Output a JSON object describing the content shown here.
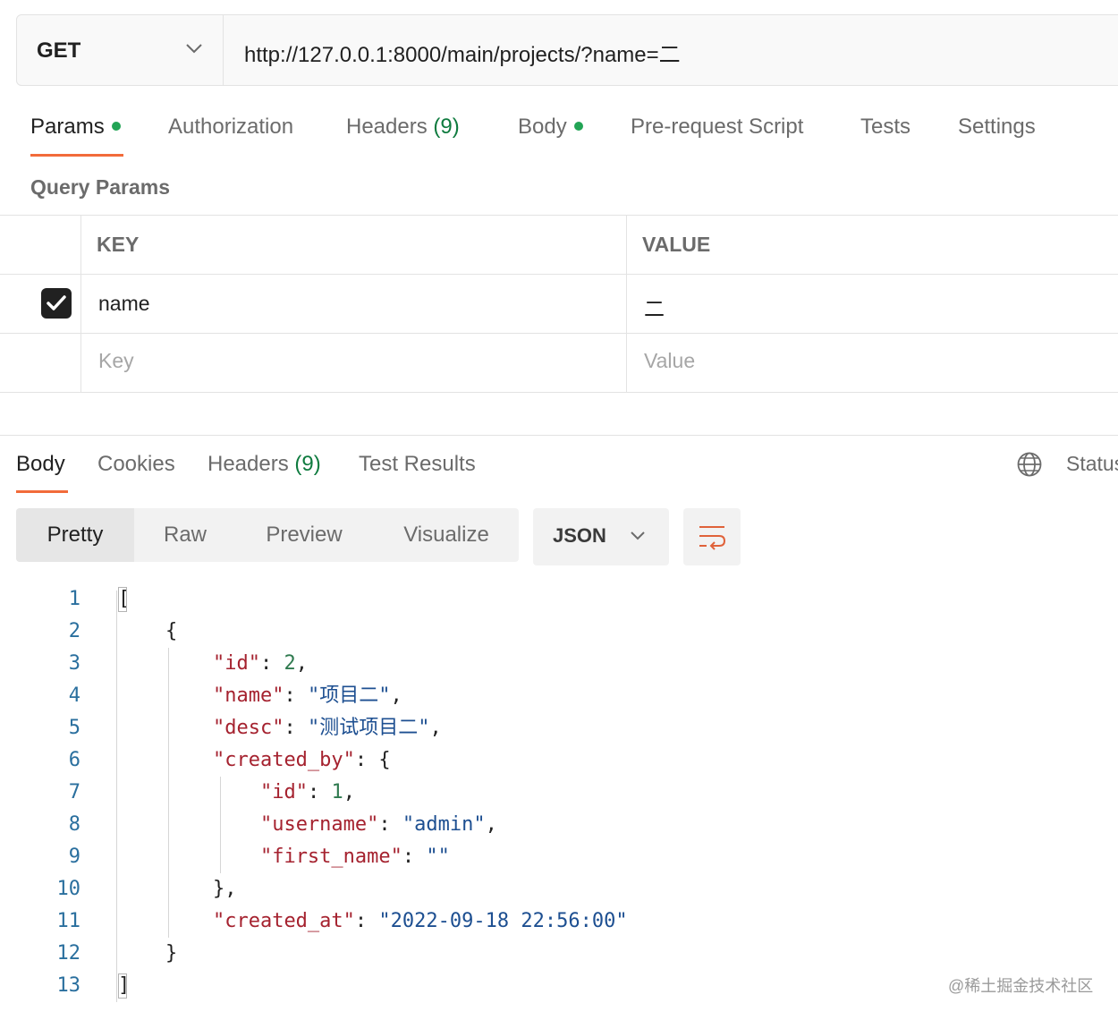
{
  "request": {
    "method": "GET",
    "url": "http://127.0.0.1:8000/main/projects/?name=二"
  },
  "request_tabs": [
    {
      "label": "Params",
      "count": "",
      "dot": true,
      "active": true
    },
    {
      "label": "Authorization",
      "count": "",
      "dot": false,
      "active": false
    },
    {
      "label": "Headers",
      "count": "(9)",
      "dot": false,
      "active": false
    },
    {
      "label": "Body",
      "count": "",
      "dot": true,
      "active": false
    },
    {
      "label": "Pre-request Script",
      "count": "",
      "dot": false,
      "active": false
    },
    {
      "label": "Tests",
      "count": "",
      "dot": false,
      "active": false
    },
    {
      "label": "Settings",
      "count": "",
      "dot": false,
      "active": false
    }
  ],
  "query_params": {
    "title": "Query Params",
    "headers": {
      "key": "KEY",
      "value": "VALUE"
    },
    "rows": [
      {
        "checked": true,
        "key": "name",
        "value": "二"
      }
    ],
    "placeholder": {
      "key": "Key",
      "value": "Value"
    }
  },
  "response": {
    "tabs": [
      {
        "label": "Body",
        "count": "",
        "active": true
      },
      {
        "label": "Cookies",
        "count": "",
        "active": false
      },
      {
        "label": "Headers",
        "count": "(9)",
        "active": false
      },
      {
        "label": "Test Results",
        "count": "",
        "active": false
      }
    ],
    "status_label": "Status",
    "view_modes": [
      "Pretty",
      "Raw",
      "Preview",
      "Visualize"
    ],
    "active_view": "Pretty",
    "format": "JSON",
    "icons": {
      "globe": "globe-icon",
      "wrap": "wrap-lines-icon"
    },
    "code_lines": [
      {
        "n": "1",
        "t": "["
      },
      {
        "n": "2",
        "t": "    {"
      },
      {
        "n": "3",
        "t": "        \"id\": 2,"
      },
      {
        "n": "4",
        "t": "        \"name\": \"项目二\","
      },
      {
        "n": "5",
        "t": "        \"desc\": \"测试项目二\","
      },
      {
        "n": "6",
        "t": "        \"created_by\": {"
      },
      {
        "n": "7",
        "t": "            \"id\": 1,"
      },
      {
        "n": "8",
        "t": "            \"username\": \"admin\","
      },
      {
        "n": "9",
        "t": "            \"first_name\": \"\""
      },
      {
        "n": "10",
        "t": "        },"
      },
      {
        "n": "11",
        "t": "        \"created_at\": \"2022-09-18 22:56:00\""
      },
      {
        "n": "12",
        "t": "    }"
      },
      {
        "n": "13",
        "t": "]"
      }
    ]
  },
  "watermark": "@稀土掘金技术社区",
  "colors": {
    "accent": "#f26b3a",
    "active_dot": "#22a455",
    "json_key": "#a5222f",
    "json_string": "#1d4f91",
    "json_number": "#2f7a4f",
    "line_number": "#2a6f9e"
  }
}
